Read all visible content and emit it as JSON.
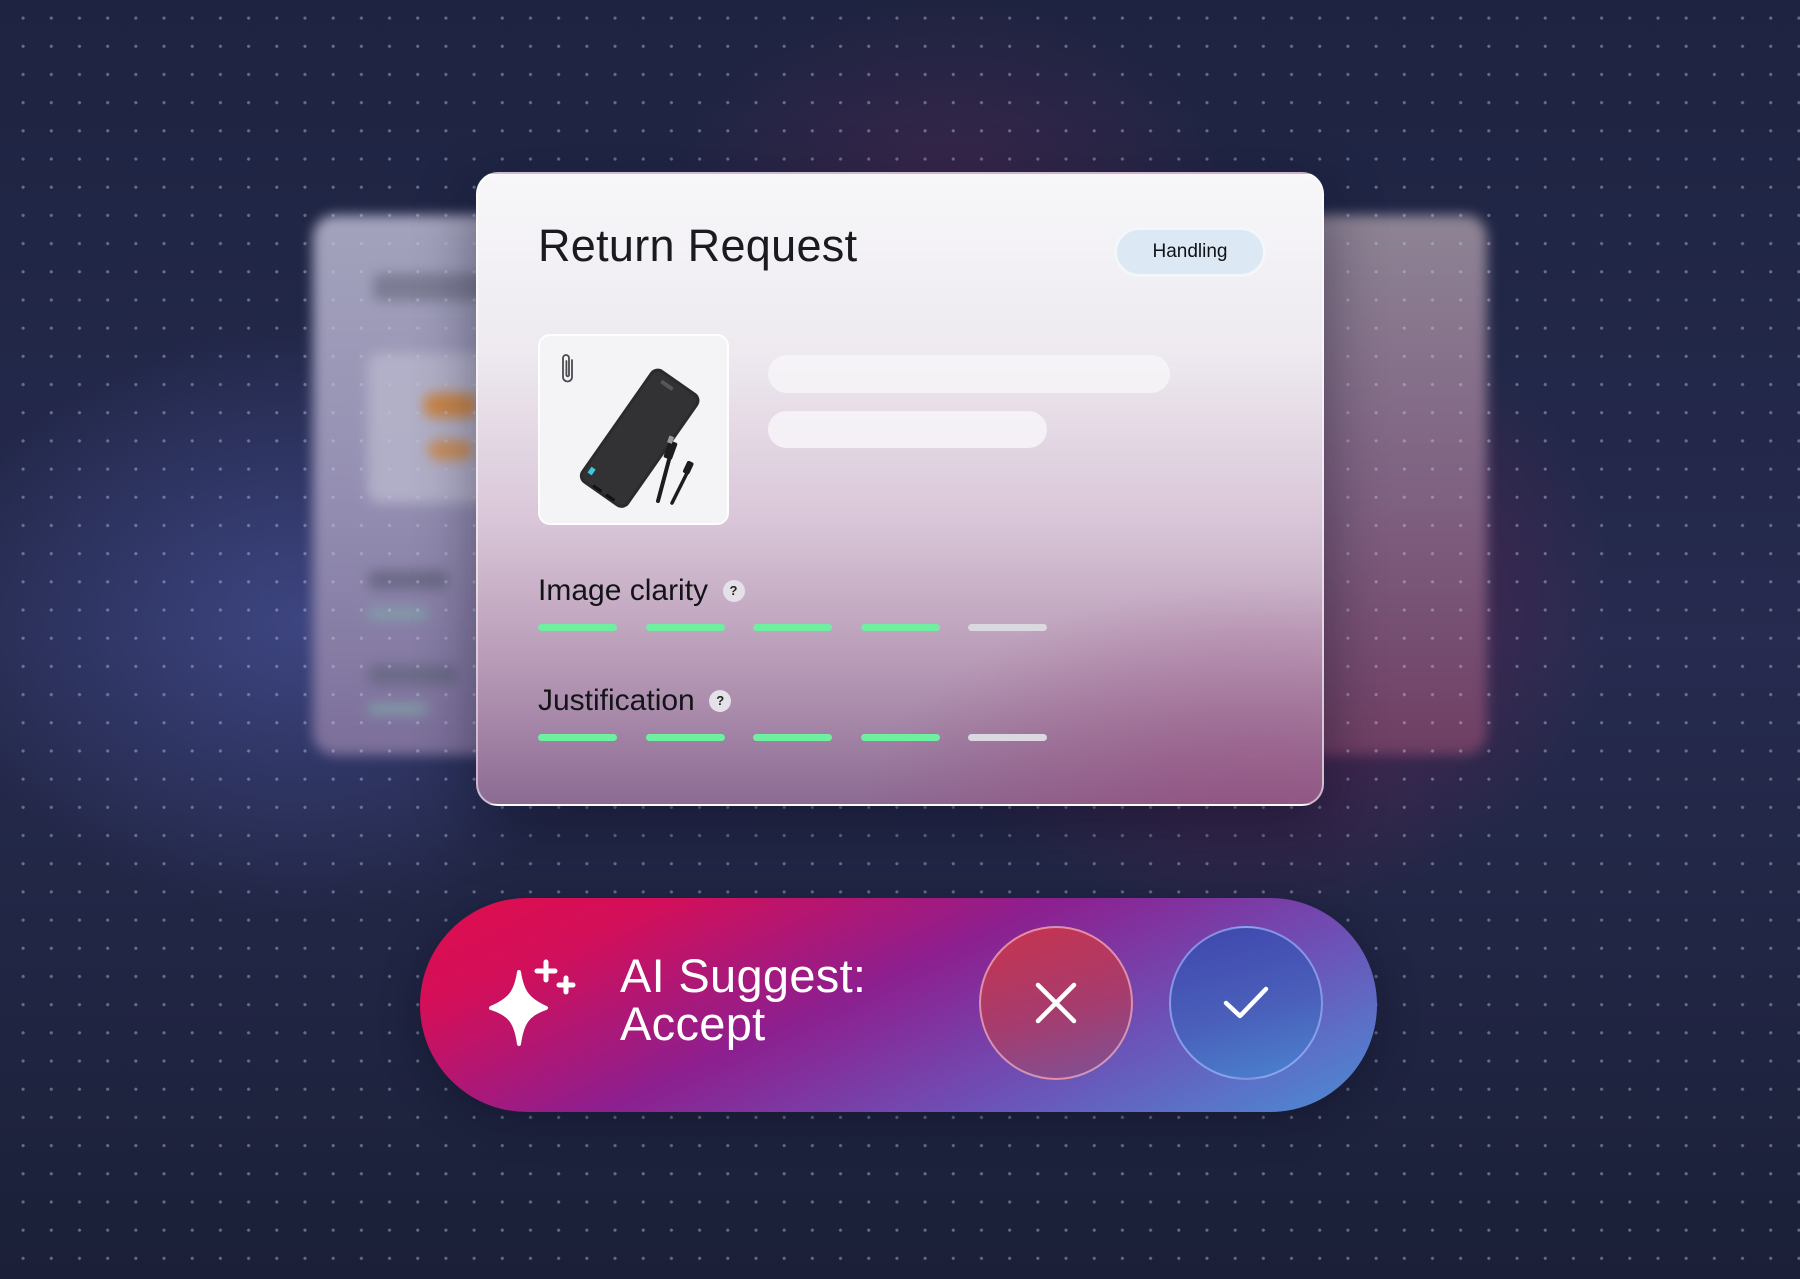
{
  "card": {
    "title": "Return Request",
    "status": "Handling",
    "attachment_icon": "paperclip-icon",
    "product_image": "power-bank-with-cable",
    "metrics": [
      {
        "label": "Image clarity",
        "help_icon": "?",
        "rating": 4,
        "max": 5
      },
      {
        "label": "Justification",
        "help_icon": "?",
        "rating": 4,
        "max": 5
      }
    ]
  },
  "ai_suggest": {
    "icon": "sparkle-icon",
    "line1": "AI Suggest:",
    "line2": "Accept",
    "reject_icon": "close-icon",
    "accept_icon": "check-icon"
  },
  "colors": {
    "rating_filled": "#6ef0a0",
    "rating_empty": "#dcd8e0",
    "badge_bg": "#dce8f4",
    "pill_start": "#e10d4b",
    "pill_end": "#4a8ed6"
  }
}
